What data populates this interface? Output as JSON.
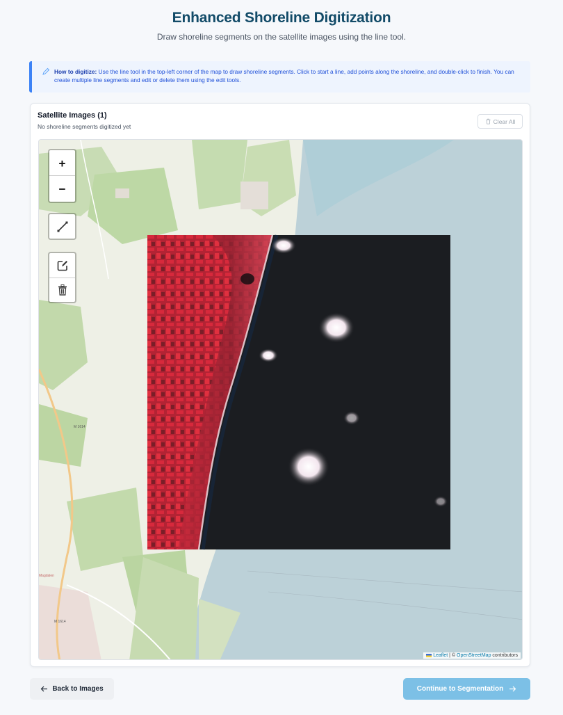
{
  "header": {
    "title": "Enhanced Shoreline Digitization",
    "subtitle": "Draw shoreline segments on the satellite images using the line tool."
  },
  "info": {
    "label": "How to digitize:",
    "text": "Use the line tool in the top-left corner of the map to draw shoreline segments. Click to start a line, add points along the shoreline, and double-click to finish. You can create multiple line segments and edit or delete them using the edit tools."
  },
  "card": {
    "title": "Satellite Images (1)",
    "status": "No shoreline segments digitized yet",
    "clear_label": "Clear All"
  },
  "map": {
    "zoom_in": "+",
    "zoom_out": "−",
    "road_labels": [
      "M 1614",
      "M 1614"
    ],
    "town_label": "Magdalen",
    "attribution_leaflet": "Leaflet",
    "attribution_sep": " | © ",
    "attribution_osm": "OpenStreetMap",
    "attribution_tail": " contributors"
  },
  "footer": {
    "back_label": "Back to Images",
    "continue_label": "Continue to Segmentation"
  },
  "colors": {
    "title": "#124b68",
    "accent": "#3b82f6",
    "continue": "#7cc0e6",
    "sea": "#bcd1d8",
    "land": "#eef0e6"
  }
}
